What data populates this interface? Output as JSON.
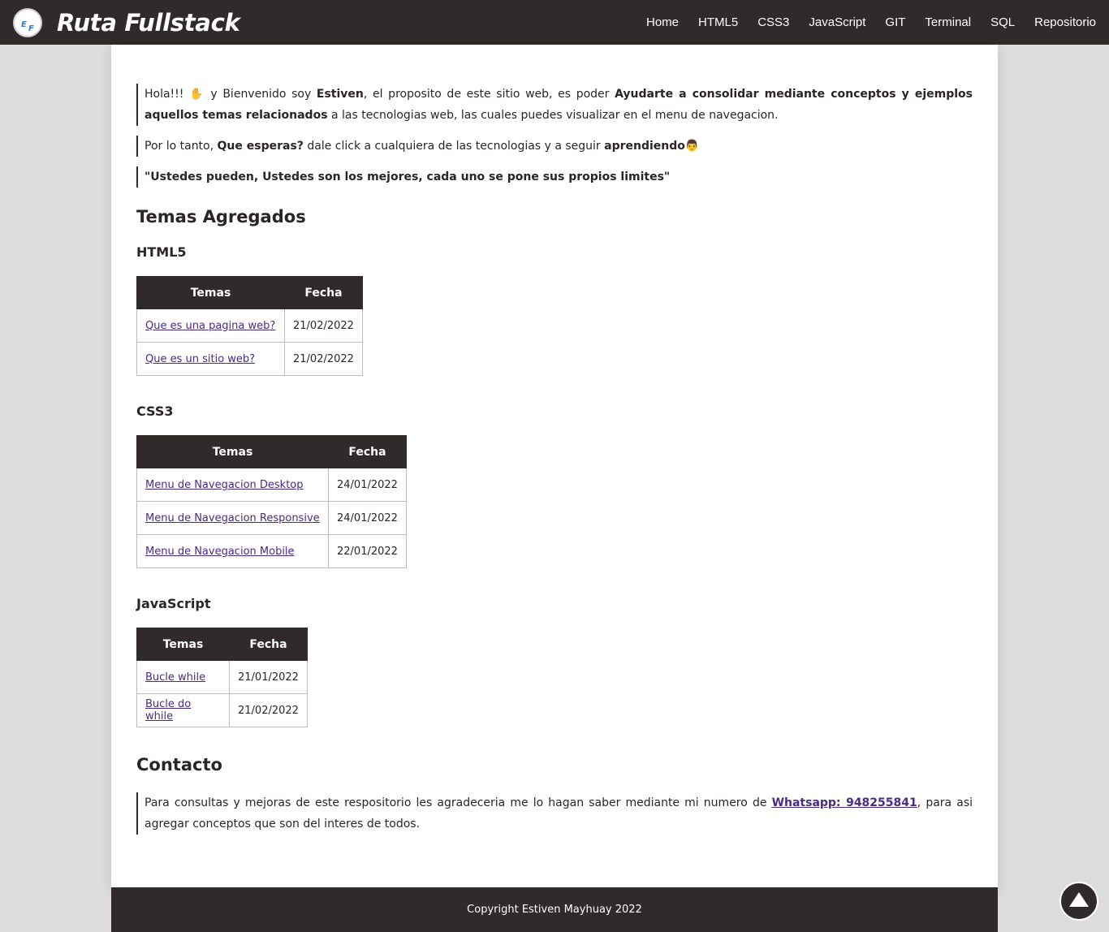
{
  "header": {
    "brand_title": "Ruta Fullstack",
    "logo_letters": [
      "E",
      "F"
    ],
    "nav": [
      "Home",
      "HTML5",
      "CSS3",
      "JavaScript",
      "GIT",
      "Terminal",
      "SQL",
      "Repositorio"
    ]
  },
  "intro": {
    "p1_start": "Hola!!! ✋  y Bienvenido soy ",
    "p1_name": "Estiven",
    "p1_mid": ", el proposito de este sitio web, es poder ",
    "p1_bold": "Ayudarte a consolidar mediante conceptos y ejemplos aquellos temas relacionados",
    "p1_end": " a las tecnologias web, las cuales puedes visualizar en el menu de navegacion.",
    "p2_start": "Por lo tanto, ",
    "p2_bold1": "Que esperas?",
    "p2_mid": " dale click a cualquiera de las tecnologias y a seguir ",
    "p2_bold2": "aprendiendo",
    "p2_emoji": "👨",
    "p3": "\"Ustedes pueden, Ustedes son los mejores, cada uno se pone sus propios limites\""
  },
  "topics": {
    "title": "Temas Agregados",
    "col_topic": "Temas",
    "col_date": "Fecha",
    "groups": [
      {
        "name": "HTML5",
        "rows": [
          {
            "topic": "Que es una pagina web?",
            "date": "21/02/2022"
          },
          {
            "topic": "Que es un sitio web?",
            "date": "21/02/2022"
          }
        ]
      },
      {
        "name": "CSS3",
        "rows": [
          {
            "topic": "Menu de Navegacion Desktop",
            "date": "24/01/2022"
          },
          {
            "topic": "Menu de Navegacion Responsive",
            "date": "24/01/2022"
          },
          {
            "topic": "Menu de Navegacion Mobile",
            "date": "22/01/2022"
          }
        ]
      },
      {
        "name": "JavaScript",
        "rows": [
          {
            "topic": "Bucle while",
            "date": "21/01/2022"
          },
          {
            "topic": "Bucle do while",
            "date": "21/02/2022"
          }
        ]
      }
    ]
  },
  "contact": {
    "title": "Contacto",
    "text_start": "Para consultas y mejoras de este respositorio les agradeceria me lo hagan saber mediante mi numero de ",
    "whatsapp": "Whatsapp: 948255841",
    "text_end": ", para asi agregar conceptos que son del interes de todos."
  },
  "footer": {
    "copyright": "Copyright Estiven Mayhuay 2022"
  }
}
